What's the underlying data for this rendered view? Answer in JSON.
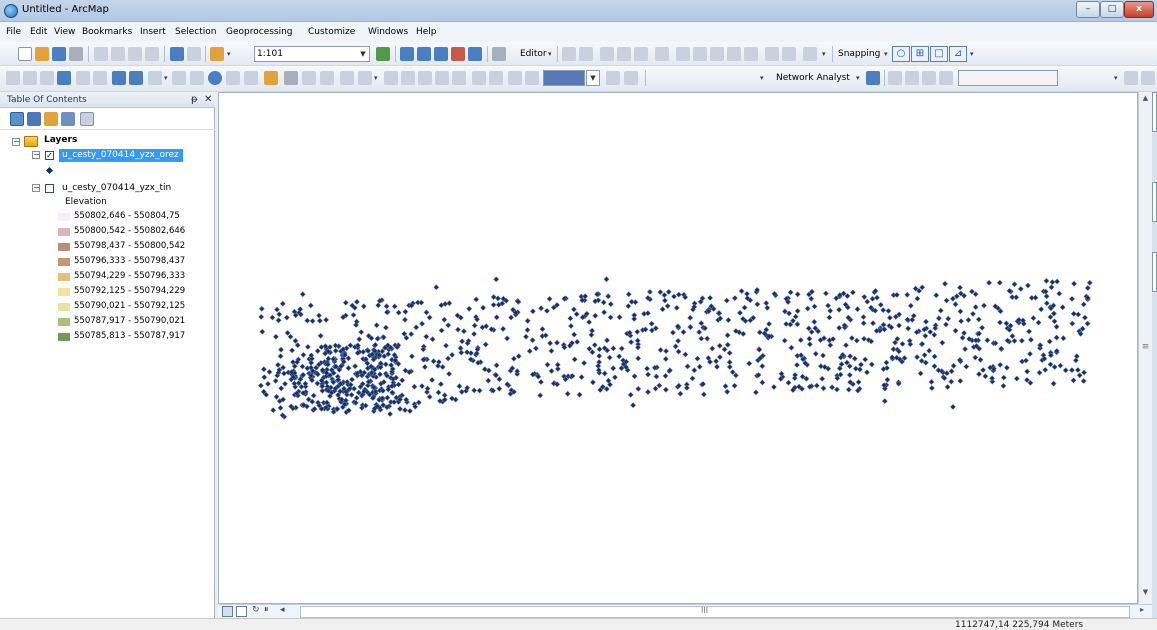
{
  "window": {
    "title": "Untitled - ArcMap",
    "icon": "arcmap-globe-icon",
    "buttons": {
      "minimize": "–",
      "maximize": "□",
      "close": "x"
    }
  },
  "menu": {
    "items": [
      "File",
      "Edit",
      "View",
      "Bookmarks",
      "Insert",
      "Selection",
      "Geoprocessing",
      "Customize",
      "Windows",
      "Help"
    ]
  },
  "toolbar": {
    "scale": "1:101",
    "editor_label": "Editor",
    "snapping_label": "Snapping",
    "network_analyst_label": "Network Analyst"
  },
  "toc": {
    "title": "Table Of Contents",
    "pin_glyph": "ᵽ",
    "close_glyph": "✕",
    "root": "Layers",
    "layers": [
      {
        "name": "u_cesty_070414_yzx_orez",
        "checked": true,
        "selected": true
      },
      {
        "name": "u_cesty_070414_yzx_tin",
        "checked": false,
        "selected": false
      }
    ],
    "legend_field": "Elevation",
    "legend": [
      {
        "label": "550802,646 - 550804,75",
        "color": "#f5eef7"
      },
      {
        "label": "550800,542 - 550802,646",
        "color": "#dcb3b6"
      },
      {
        "label": "550798,437 - 550800,542",
        "color": "#b88f7a"
      },
      {
        "label": "550796,333 - 550798,437",
        "color": "#c9956a"
      },
      {
        "label": "550794,229 - 550796,333",
        "color": "#e6bf78"
      },
      {
        "label": "550792,125 - 550794,229",
        "color": "#f0e2a0"
      },
      {
        "label": "550790,021 - 550792,125",
        "color": "#e6e6a0"
      },
      {
        "label": "550787,917 - 550790,021",
        "color": "#a8c07a"
      },
      {
        "label": "550785,813 - 550787,917",
        "color": "#6e9a5a"
      }
    ]
  },
  "map": {
    "point_color": "#1b2d5c",
    "point_outline": "#5a7ab8",
    "scroll_grip": "III"
  },
  "status": {
    "coordinates": "1112747,14  225,794 Meters"
  }
}
